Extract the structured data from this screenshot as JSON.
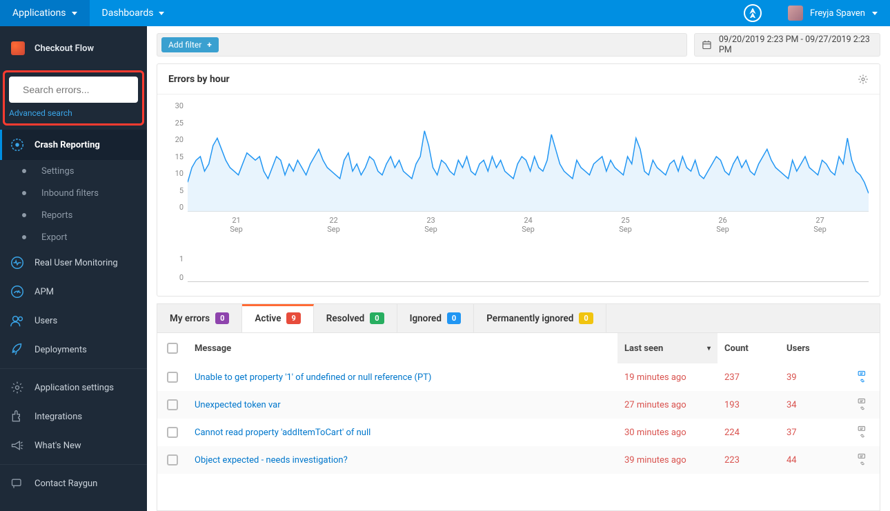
{
  "topbar": {
    "applications": "Applications",
    "dashboards": "Dashboards",
    "user_name": "Freyja Spaven"
  },
  "sidebar": {
    "app_name": "Checkout Flow",
    "search_placeholder": "Search errors...",
    "advanced_search": "Advanced search",
    "crash_reporting": "Crash Reporting",
    "subs": [
      "Settings",
      "Inbound filters",
      "Reports",
      "Export"
    ],
    "rum": "Real User Monitoring",
    "apm": "APM",
    "users": "Users",
    "deployments": "Deployments",
    "app_settings": "Application settings",
    "integrations": "Integrations",
    "whats_new": "What's New",
    "contact": "Contact Raygun"
  },
  "filters": {
    "add_filter": "Add filter",
    "daterange": "09/20/2019 2:23 PM - 09/27/2019 2:23 PM"
  },
  "chart": {
    "title": "Errors by hour"
  },
  "chart_data": {
    "type": "line",
    "title": "Errors by hour",
    "xlabel": "",
    "ylabel": "",
    "ylim": [
      0,
      30
    ],
    "y_ticks": [
      "30",
      "25",
      "20",
      "15",
      "10",
      "5",
      "0"
    ],
    "x_ticks": [
      "21\nSep",
      "22\nSep",
      "23\nSep",
      "24\nSep",
      "25\nSep",
      "26\nSep",
      "27\nSep"
    ],
    "lower_y_ticks": [
      "1",
      "0"
    ],
    "values": [
      8,
      12,
      14,
      15,
      11,
      13,
      18,
      20,
      17,
      14,
      12,
      11,
      10,
      13,
      16,
      15,
      14,
      15,
      11,
      9,
      12,
      15,
      14,
      10,
      13,
      11,
      14,
      12,
      10,
      13,
      15,
      17,
      14,
      12,
      11,
      10,
      9,
      14,
      16,
      11,
      13,
      10,
      12,
      15,
      14,
      11,
      10,
      13,
      15,
      12,
      14,
      11,
      10,
      9,
      13,
      15,
      22,
      18,
      12,
      10,
      14,
      13,
      11,
      10,
      14,
      12,
      15,
      11,
      10,
      13,
      14,
      11,
      15,
      12,
      14,
      11,
      10,
      9,
      13,
      15,
      14,
      11,
      15,
      12,
      11,
      14,
      21,
      17,
      13,
      11,
      10,
      9,
      14,
      12,
      11,
      10,
      13,
      14,
      15,
      11,
      14,
      12,
      11,
      10,
      15,
      13,
      20,
      17,
      11,
      10,
      14,
      12,
      11,
      10,
      13,
      14,
      11,
      15,
      12,
      11,
      14,
      10,
      9,
      11,
      13,
      15,
      14,
      11,
      10,
      13,
      15,
      12,
      14,
      11,
      10,
      13,
      15,
      17,
      14,
      12,
      11,
      10,
      9,
      14,
      11,
      13,
      15,
      12,
      11,
      10,
      14,
      13,
      11,
      10,
      15,
      13,
      20,
      14,
      11,
      10,
      8,
      5
    ]
  },
  "tabs": {
    "my_errors": {
      "label": "My errors",
      "count": "0"
    },
    "active": {
      "label": "Active",
      "count": "9"
    },
    "resolved": {
      "label": "Resolved",
      "count": "0"
    },
    "ignored": {
      "label": "Ignored",
      "count": "0"
    },
    "permanently_ignored": {
      "label": "Permanently ignored",
      "count": "0"
    }
  },
  "table": {
    "headers": {
      "message": "Message",
      "last_seen": "Last seen",
      "count": "Count",
      "users": "Users"
    },
    "rows": [
      {
        "message": "Unable to get property '1' of undefined or null reference (PT)",
        "last_seen": "19 minutes ago",
        "count": "237",
        "users": "39"
      },
      {
        "message": "Unexpected token var",
        "last_seen": "27 minutes ago",
        "count": "193",
        "users": "34"
      },
      {
        "message": "Cannot read property 'addItemToCart' of null",
        "last_seen": "30 minutes ago",
        "count": "224",
        "users": "37"
      },
      {
        "message": "Object expected - needs investigation?",
        "last_seen": "39 minutes ago",
        "count": "223",
        "users": "44"
      }
    ]
  }
}
